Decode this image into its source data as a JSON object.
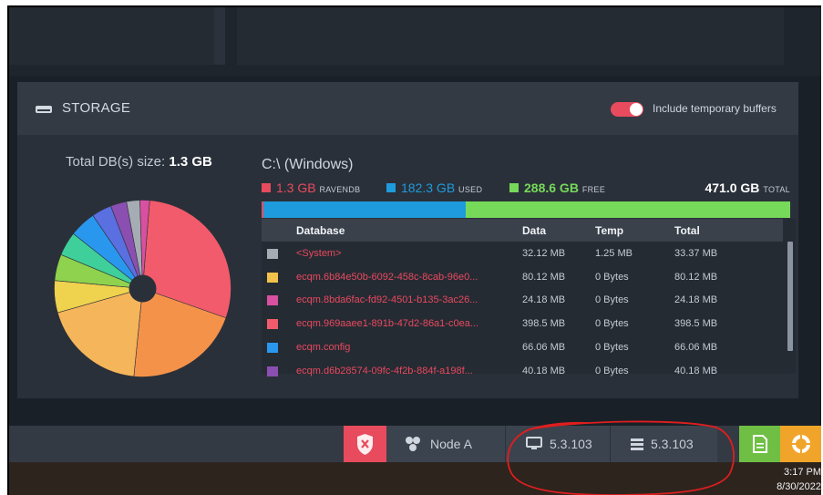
{
  "storage": {
    "title": "STORAGE",
    "toggle_label": "Include temporary buffers",
    "toggle_on": true,
    "total_db_label": "Total DB(s) size:",
    "total_db_value": "1.3 GB",
    "drive_name": "C:\\ (Windows)",
    "legend": {
      "ravendb_value": "1.3 GB",
      "ravendb_caption": "RAVENDB",
      "used_value": "182.3 GB",
      "used_caption": "USED",
      "free_value": "288.6 GB",
      "free_caption": "FREE",
      "total_value": "471.0 GB",
      "total_caption": "TOTAL"
    },
    "usage_fractions": {
      "ravendb": 0.0028,
      "used": 0.387,
      "free": 0.613
    },
    "colors": {
      "ravendb": "#e84b5d",
      "used": "#1e9bdc",
      "free": "#77d95a",
      "accent": "#e84b5d"
    },
    "table": {
      "headers": {
        "database": "Database",
        "data": "Data",
        "temp": "Temp",
        "total": "Total"
      },
      "rows": [
        {
          "name": "<System>",
          "data": "32.12 MB",
          "temp": "1.25 MB",
          "total": "33.37 MB",
          "color": "#a6acb3"
        },
        {
          "name": "ecqm.6b84e50b-6092-458c-8cab-96e0...",
          "data": "80.12 MB",
          "temp": "0 Bytes",
          "total": "80.12 MB",
          "color": "#f2c24a"
        },
        {
          "name": "ecqm.8bda6fac-fd92-4501-b135-3ac26...",
          "data": "24.18 MB",
          "temp": "0 Bytes",
          "total": "24.18 MB",
          "color": "#d850a0"
        },
        {
          "name": "ecqm.969aaee1-891b-47d2-86a1-c0ea...",
          "data": "398.5 MB",
          "temp": "0 Bytes",
          "total": "398.5 MB",
          "color": "#f25b6b"
        },
        {
          "name": "ecqm.config",
          "data": "66.06 MB",
          "temp": "0 Bytes",
          "total": "66.06 MB",
          "color": "#2a97ee"
        },
        {
          "name": "ecqm.d6b28574-09fc-4f2b-884f-a198f...",
          "data": "40.18 MB",
          "temp": "0 Bytes",
          "total": "40.18 MB",
          "color": "#8a4fb0"
        }
      ]
    },
    "pie_slices": [
      {
        "value": 398.5,
        "color": "#f25b6b"
      },
      {
        "value": 290,
        "color": "#f5924a"
      },
      {
        "value": 260,
        "color": "#f5b55a"
      },
      {
        "value": 80.12,
        "color": "#efd24e"
      },
      {
        "value": 66,
        "color": "#8ed24e"
      },
      {
        "value": 60,
        "color": "#3fcf9a"
      },
      {
        "value": 66.06,
        "color": "#2a97ee"
      },
      {
        "value": 50,
        "color": "#5a6fe0"
      },
      {
        "value": 40.18,
        "color": "#8a4fb0"
      },
      {
        "value": 33.37,
        "color": "#a6acb3"
      },
      {
        "value": 24.18,
        "color": "#d850a0"
      }
    ]
  },
  "statusbar": {
    "node_label": "Node A",
    "studio_version": "5.3.103",
    "server_version": "5.3.103"
  },
  "taskbar": {
    "time": "3:17 PM",
    "date": "8/30/2022"
  }
}
